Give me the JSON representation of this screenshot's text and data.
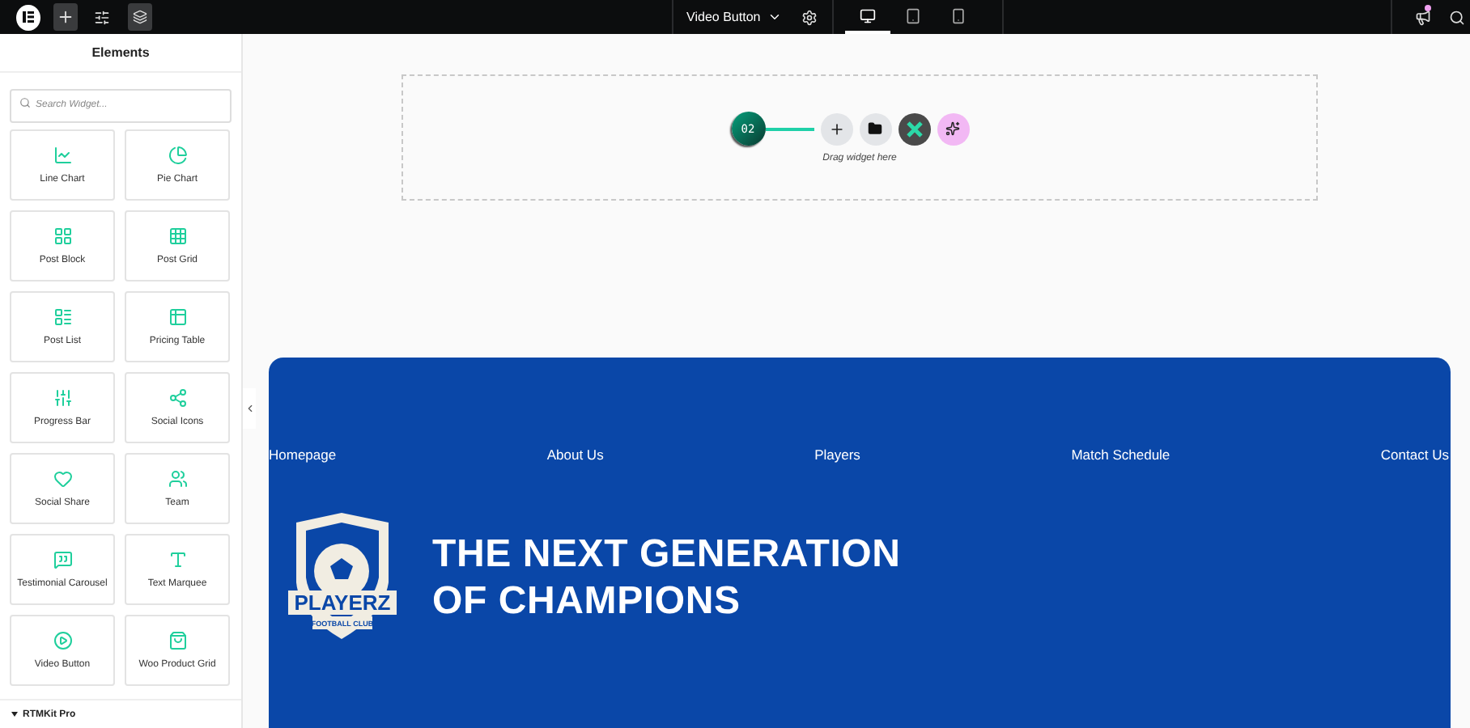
{
  "topbar": {
    "document": "Video Button",
    "devices": [
      {
        "selected": true
      },
      {
        "selected": false
      },
      {
        "selected": false
      }
    ],
    "notification": true
  },
  "sidebar": {
    "title": "Elements",
    "search": {
      "placeholder": "Search Widget..."
    },
    "widgets": [
      {
        "label": "Line Chart"
      },
      {
        "label": "Pie Chart"
      },
      {
        "label": "Post Block"
      },
      {
        "label": "Post Grid"
      },
      {
        "label": "Post List"
      },
      {
        "label": "Pricing Table"
      },
      {
        "label": "Progress Bar"
      },
      {
        "label": "Social Icons"
      },
      {
        "label": "Social Share"
      },
      {
        "label": "Team"
      },
      {
        "label": "Testimonial Carousel"
      },
      {
        "label": "Text Marquee"
      },
      {
        "label": "Video Button"
      },
      {
        "label": "Woo Product Grid"
      }
    ],
    "section": {
      "title": "RTMKit Pro",
      "expanded": true
    }
  },
  "dropzone": {
    "step": "02",
    "hint": "Drag widget here"
  },
  "hero": {
    "nav": [
      "Homepage",
      "About Us",
      "Players",
      "Match Schedule",
      "Contact Us"
    ],
    "logo": {
      "name": "PLAYERZ",
      "tagline": "FOOTBALL CLUB"
    },
    "headline": [
      "THE NEXT GENERATION",
      "OF CHAMPIONS"
    ]
  }
}
